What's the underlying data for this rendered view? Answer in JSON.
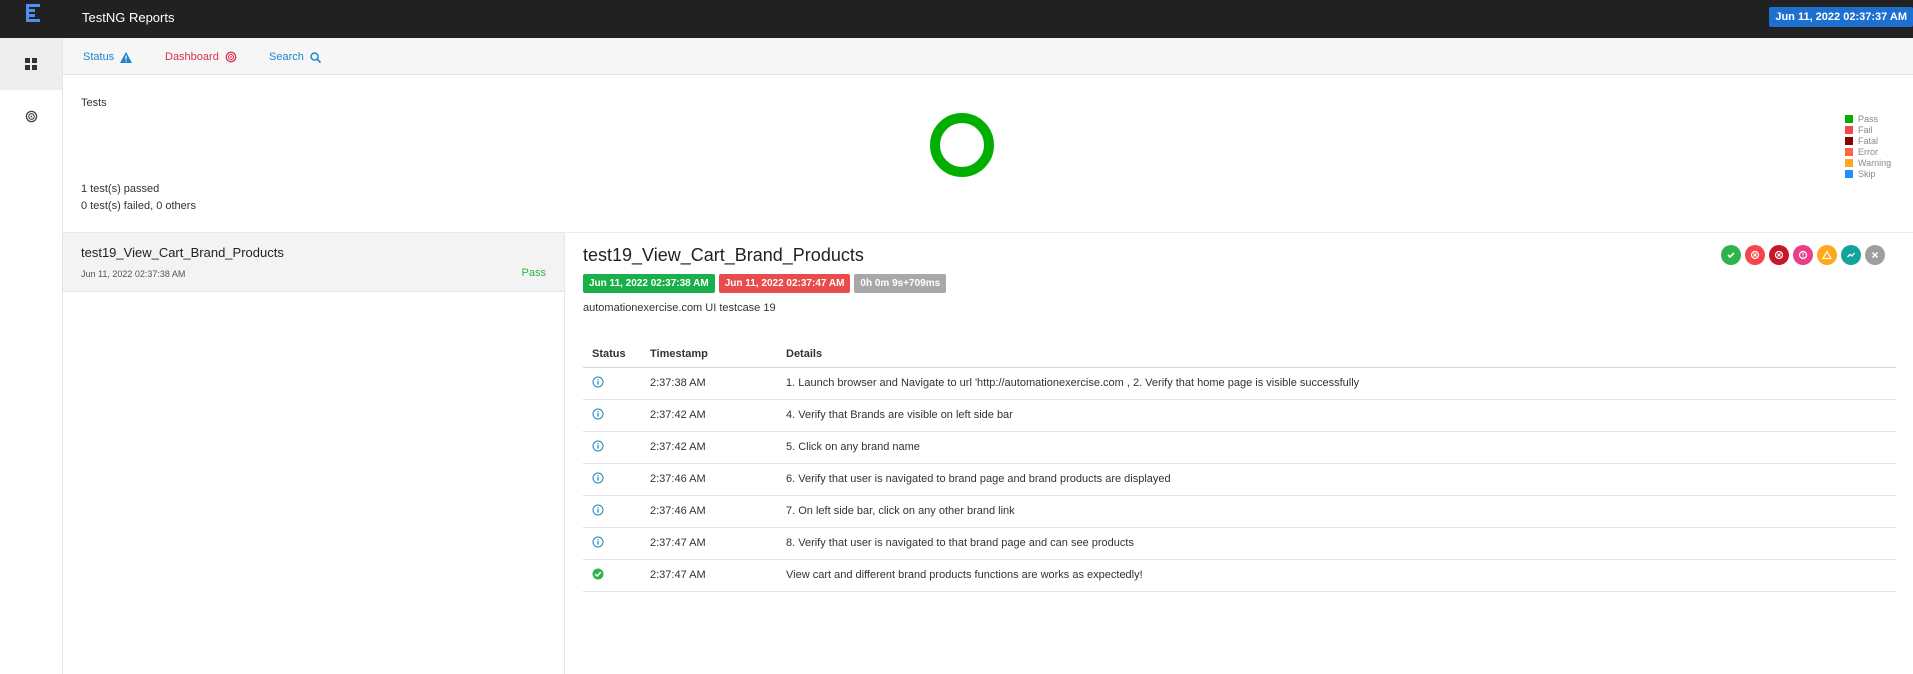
{
  "app": {
    "title": "TestNG Reports",
    "report_time": "Jun 11, 2022 02:37:37 AM",
    "rail": {
      "items": [
        "dashboard-grid-icon",
        "dashboard-gauge-icon"
      ]
    }
  },
  "nav": {
    "status": "Status",
    "dashboard": "Dashboard",
    "search": "Search"
  },
  "dashboard": {
    "title": "Tests",
    "passed": "1 test(s) passed",
    "failed": "0 test(s) failed, 0 others",
    "chart_data": {
      "type": "pie",
      "categories": [
        "Pass",
        "Fail",
        "Fatal",
        "Error",
        "Warning",
        "Skip"
      ],
      "values": [
        1,
        0,
        0,
        0,
        0,
        0
      ],
      "colors": [
        "#00af00",
        "#f7464a",
        "#8b0000",
        "#ff6347",
        "#ffa81c",
        "#1e90ff"
      ],
      "legend": "right"
    }
  },
  "tests": [
    {
      "name": "test19_View_Cart_Brand_Products",
      "time": "Jun 11, 2022 02:37:38 AM",
      "status": "Pass"
    }
  ],
  "detail": {
    "title": "test19_View_Cart_Brand_Products",
    "start": "Jun 11, 2022 02:37:38 AM",
    "end": "Jun 11, 2022 02:37:47 AM",
    "duration": "0h 0m 9s+709ms",
    "description": "automationexercise.com UI testcase 19",
    "filters": [
      {
        "name": "pass-filter-icon",
        "color": "#2fb34a"
      },
      {
        "name": "fail-filter-icon",
        "color": "#f7464a"
      },
      {
        "name": "fatal-filter-icon",
        "color": "#c5182c"
      },
      {
        "name": "error-filter-icon",
        "color": "#e83e8c"
      },
      {
        "name": "warning-filter-icon",
        "color": "#ffa81c"
      },
      {
        "name": "info-filter-icon",
        "color": "#12a39a"
      },
      {
        "name": "clear-filter-icon",
        "color": "#9e9e9e"
      }
    ],
    "log_headers": {
      "status": "Status",
      "timestamp": "Timestamp",
      "details": "Details"
    },
    "log": [
      {
        "status": "info",
        "time": "2:37:38 AM",
        "details": "1. Launch browser and Navigate to url 'http://automationexercise.com , 2. Verify that home page is visible successfully"
      },
      {
        "status": "info",
        "time": "2:37:42 AM",
        "details": "4. Verify that Brands are visible on left side bar"
      },
      {
        "status": "info",
        "time": "2:37:42 AM",
        "details": "5. Click on any brand name"
      },
      {
        "status": "info",
        "time": "2:37:46 AM",
        "details": "6. Verify that user is navigated to brand page and brand products are displayed"
      },
      {
        "status": "info",
        "time": "2:37:46 AM",
        "details": "7. On left side bar, click on any other brand link"
      },
      {
        "status": "info",
        "time": "2:37:47 AM",
        "details": "8. Verify that user is navigated to that brand page and can see products"
      },
      {
        "status": "pass",
        "time": "2:37:47 AM",
        "details": "View cart and different brand products functions are works as expectedly!"
      }
    ]
  }
}
